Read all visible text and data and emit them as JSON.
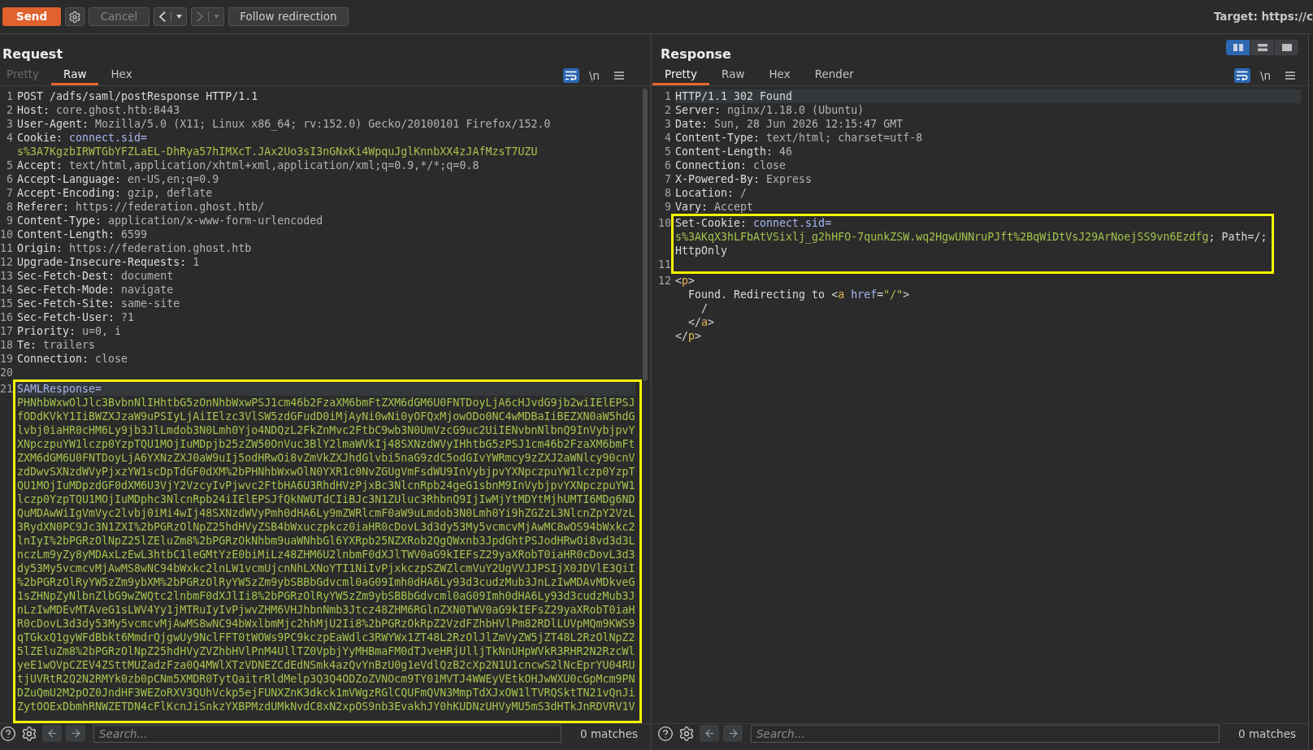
{
  "toolbar": {
    "send": {
      "label": "Send"
    },
    "cancel": {
      "label": "Cancel",
      "disabled": true
    },
    "back": {
      "disabled": false
    },
    "forward": {
      "disabled": true
    },
    "follow_redirection": {
      "label": "Follow redirection",
      "disabled": false
    },
    "target": "Target: https://c"
  },
  "request": {
    "title": "Request",
    "tabs": [
      {
        "label": "Pretty",
        "selected": false,
        "disabled": true
      },
      {
        "label": "Raw",
        "selected": true,
        "disabled": false
      },
      {
        "label": "Hex",
        "selected": false,
        "disabled": false
      }
    ],
    "wrap_lines": {
      "on": true
    },
    "show_newlines": {
      "label": "\\n",
      "on": false
    },
    "blocks": [
      {
        "kind": "plain",
        "lines": [
          {
            "number": "1",
            "current": false,
            "rows": [
              [
                {
                  "kind": "plain",
                  "text": "POST /adfs/saml/postResponse HTTP/1.1"
                }
              ]
            ]
          },
          {
            "number": "2",
            "current": false,
            "rows": [
              [
                {
                  "kind": "name",
                  "text": "Host:"
                },
                {
                  "kind": "value",
                  "text": " core.ghost.htb:8443"
                }
              ]
            ]
          },
          {
            "number": "3",
            "current": false,
            "rows": [
              [
                {
                  "kind": "name",
                  "text": "User-Agent:"
                },
                {
                  "kind": "value",
                  "text": " Mozilla/5.0 (X11; Linux x86_64; rv:152.0) Gecko/20100101 Firefox/152.0"
                }
              ]
            ]
          },
          {
            "number": "4",
            "current": false,
            "rows": [
              [
                {
                  "kind": "name",
                  "text": "Cookie:"
                },
                {
                  "kind": "param_name",
                  "text": " connect.sid="
                }
              ],
              [
                {
                  "kind": "param_value",
                  "text": "s%3A7KgzbIRWTGbYFZLaEL-DhRya57hIMXcT.JAx2Uo3sI3nGNxKi4WpquJglKnnbXX4zJAfMzsT7UZU"
                }
              ]
            ]
          },
          {
            "number": "5",
            "current": false,
            "rows": [
              [
                {
                  "kind": "name",
                  "text": "Accept:"
                },
                {
                  "kind": "value",
                  "text": " text/html,application/xhtml+xml,application/xml;q=0.9,*/*;q=0.8"
                }
              ]
            ]
          },
          {
            "number": "6",
            "current": false,
            "rows": [
              [
                {
                  "kind": "name",
                  "text": "Accept-Language:"
                },
                {
                  "kind": "value",
                  "text": " en-US,en;q=0.9"
                }
              ]
            ]
          },
          {
            "number": "7",
            "current": false,
            "rows": [
              [
                {
                  "kind": "name",
                  "text": "Accept-Encoding:"
                },
                {
                  "kind": "value",
                  "text": " gzip, deflate"
                }
              ]
            ]
          },
          {
            "number": "8",
            "current": false,
            "rows": [
              [
                {
                  "kind": "name",
                  "text": "Referer:"
                },
                {
                  "kind": "value",
                  "text": " https://federation.ghost.htb/"
                }
              ]
            ]
          },
          {
            "number": "9",
            "current": false,
            "rows": [
              [
                {
                  "kind": "name",
                  "text": "Content-Type:"
                },
                {
                  "kind": "value",
                  "text": " application/x-www-form-urlencoded"
                }
              ]
            ]
          },
          {
            "number": "10",
            "current": false,
            "rows": [
              [
                {
                  "kind": "name",
                  "text": "Content-Length:"
                },
                {
                  "kind": "value",
                  "text": " 6599"
                }
              ]
            ]
          },
          {
            "number": "11",
            "current": false,
            "rows": [
              [
                {
                  "kind": "name",
                  "text": "Origin:"
                },
                {
                  "kind": "value",
                  "text": " https://federation.ghost.htb"
                }
              ]
            ]
          },
          {
            "number": "12",
            "current": false,
            "rows": [
              [
                {
                  "kind": "name",
                  "text": "Upgrade-Insecure-Requests:"
                },
                {
                  "kind": "value",
                  "text": " 1"
                }
              ]
            ]
          },
          {
            "number": "13",
            "current": false,
            "rows": [
              [
                {
                  "kind": "name",
                  "text": "Sec-Fetch-Dest:"
                },
                {
                  "kind": "value",
                  "text": " document"
                }
              ]
            ]
          },
          {
            "number": "14",
            "current": false,
            "rows": [
              [
                {
                  "kind": "name",
                  "text": "Sec-Fetch-Mode:"
                },
                {
                  "kind": "value",
                  "text": " navigate"
                }
              ]
            ]
          },
          {
            "number": "15",
            "current": false,
            "rows": [
              [
                {
                  "kind": "name",
                  "text": "Sec-Fetch-Site:"
                },
                {
                  "kind": "value",
                  "text": " same-site"
                }
              ]
            ]
          },
          {
            "number": "16",
            "current": false,
            "rows": [
              [
                {
                  "kind": "name",
                  "text": "Sec-Fetch-User:"
                },
                {
                  "kind": "value",
                  "text": " ?1"
                }
              ]
            ]
          },
          {
            "number": "17",
            "current": false,
            "rows": [
              [
                {
                  "kind": "name",
                  "text": "Priority:"
                },
                {
                  "kind": "value",
                  "text": " u=0, i"
                }
              ]
            ]
          },
          {
            "number": "18",
            "current": false,
            "rows": [
              [
                {
                  "kind": "name",
                  "text": "Te:"
                },
                {
                  "kind": "value",
                  "text": " trailers"
                }
              ]
            ]
          },
          {
            "number": "19",
            "current": false,
            "rows": [
              [
                {
                  "kind": "name",
                  "text": "Connection:"
                },
                {
                  "kind": "value",
                  "text": " close"
                }
              ]
            ]
          },
          {
            "number": "20",
            "current": false
          }
        ]
      },
      {
        "kind": "framed",
        "lines": [
          {
            "number": "21",
            "current": true,
            "rows": [
              [
                {
                  "kind": "param_name",
                  "text": "SAMLResponse="
                }
              ],
              [
                {
                  "kind": "param_value",
                  "text": "PHNhbWxwOlJlc3BvbnNlIHhtbG5zOnNhbWxwPSJ1cm46b2FzaXM6bmFtZXM6dGM6U0FNTDoyLjA6cHJvdG9jb2wiIElEPSJ"
                }
              ],
              [
                {
                  "kind": "param_value",
                  "text": "fODdKVkY1IiBWZXJzaW9uPSIyLjAiIElzc3VlSW5zdGFudD0iMjAyNi0wNi0yOFQxMjowODo0NC4wMDBaIiBEZXN0aW5hdG"
                }
              ],
              [
                {
                  "kind": "param_value",
                  "text": "lvbj0iaHR0cHM6Ly9jb3JlLmdob3N0Lmh0Yjo4NDQzL2FkZnMvc2FtbC9wb3N0UmVzcG9uc2UiIENvbnNlbnQ9InVybjpvY"
                }
              ],
              [
                {
                  "kind": "param_value",
                  "text": "XNpczpuYW1lczp0YzpTQU1MOjIuMDpjb25zZW50OnVuc3BlY2lmaWVkIj48SXNzdWVyIHhtbG5zPSJ1cm46b2FzaXM6bmFt"
                }
              ],
              [
                {
                  "kind": "param_value",
                  "text": "ZXM6dGM6U0FNTDoyLjA6YXNzZXJ0aW9uIj5odHRwOi8vZmVkZXJhdGlvbi5naG9zdC5odGIvYWRmcy9zZXJ2aWNlcy90cnV"
                }
              ],
              [
                {
                  "kind": "param_value",
                  "text": "zdDwvSXNzdWVyPjxzYW1scDpTdGF0dXM%2bPHNhbWxwOlN0YXR1c0NvZGUgVmFsdWU9InVybjpvYXNpczpuYW1lczp0YzpT"
                }
              ],
              [
                {
                  "kind": "param_value",
                  "text": "QU1MOjIuMDpzdGF0dXM6U3VjY2VzcyIvPjwvc2FtbHA6U3RhdHVzPjxBc3NlcnRpb24geG1sbnM9InVybjpvYXNpczpuYW1"
                }
              ],
              [
                {
                  "kind": "param_value",
                  "text": "lczp0YzpTQU1MOjIuMDphc3NlcnRpb24iIElEPSJfQkNWUTdCIiBJc3N1ZUluc3RhbnQ9IjIwMjYtMDYtMjhUMTI6MDg6ND"
                }
              ],
              [
                {
                  "kind": "param_value",
                  "text": "QuMDAwWiIgVmVyc2lvbj0iMi4wIj48SXNzdWVyPmh0dHA6Ly9mZWRlcmF0aW9uLmdob3N0Lmh0Yi9hZGZzL3NlcnZpY2VzL"
                }
              ],
              [
                {
                  "kind": "param_value",
                  "text": "3RydXN0PC9Jc3N1ZXI%2bPGRzOlNpZ25hdHVyZSB4bWxuczpkcz0iaHR0cDovL3d3dy53My5vcmcvMjAwMC8wOS94bWxkc2"
                }
              ],
              [
                {
                  "kind": "param_value",
                  "text": "lnIyI%2bPGRzOlNpZ25lZEluZm8%2bPGRzOkNhbm9uaWNhbGl6YXRpb25NZXRob2QgQWxnb3JpdGhtPSJodHRwOi8vd3d3L"
                }
              ],
              [
                {
                  "kind": "param_value",
                  "text": "nczLm9yZy8yMDAxLzEwL3htbC1leGMtYzE0biMiLz48ZHM6U2lnbmF0dXJlTWV0aG9kIEFsZ29yaXRobT0iaHR0cDovL3d3"
                }
              ],
              [
                {
                  "kind": "param_value",
                  "text": "dy53My5vcmcvMjAwMS8wNC94bWxkc2lnLW1vcmUjcnNhLXNoYTI1NiIvPjxkczpSZWZlcmVuY2UgVVJJPSIjX0JDVlE3QiI"
                }
              ],
              [
                {
                  "kind": "param_value",
                  "text": "%2bPGRzOlRyYW5zZm9ybXM%2bPGRzOlRyYW5zZm9ybSBBbGdvcml0aG09Imh0dHA6Ly93d3cudzMub3JnLzIwMDAvMDkveG"
                }
              ],
              [
                {
                  "kind": "param_value",
                  "text": "1sZHNpZyNlbnZlbG9wZWQtc2lnbmF0dXJlIi8%2bPGRzOlRyYW5zZm9ybSBBbGdvcml0aG09Imh0dHA6Ly93d3cudzMub3J"
                }
              ],
              [
                {
                  "kind": "param_value",
                  "text": "nLzIwMDEvMTAveG1sLWV4Yy1jMTRuIyIvPjwvZHM6VHJhbnNmb3Jtcz48ZHM6RGlnZXN0TWV0aG9kIEFsZ29yaXRobT0iaH"
                }
              ],
              [
                {
                  "kind": "param_value",
                  "text": "R0cDovL3d3dy53My5vcmcvMjAwMS8wNC94bWxlbmMjc2hhMjU2Ii8%2bPGRzOkRpZ2VzdFZhbHVlPm82RDlLUVpMQm9KWS9"
                }
              ],
              [
                {
                  "kind": "param_value",
                  "text": "qTGkxQ1gyWFdBbkt6MmdrQjgwUy9NclFFT0tWOWs9PC9kczpEaWdlc3RWYWx1ZT48L2RzOlJlZmVyZW5jZT48L2RzOlNpZ2"
                }
              ],
              [
                {
                  "kind": "param_value",
                  "text": "5lZEluZm8%2bPGRzOlNpZ25hdHVyZVZhbHVlPnM4UllTZ0VpbjYyMHBmaFM0dTJveHRjUlljTkNnUHpWVkR3RHR2N2RzcWl"
                }
              ],
              [
                {
                  "kind": "param_value",
                  "text": "yeE1wOVpCZEV4ZSttMUZadzFza0Q4MWlXTzVDNEZCdEdNSmk4azQvYnBzU0g1eVdlQzB2cXp2N1U1cncwS2lNcEprYU04RU"
                }
              ],
              [
                {
                  "kind": "param_value",
                  "text": "tjUVRtR2Q2N2RMYk0zb0pCNm5XMDR0TytQaitrRldMelp3Q3Q4ODZoZVNOcm9TY01MVTJ4WWEyVEtkOHJwWXU0cGpMcm9PN"
                }
              ],
              [
                {
                  "kind": "param_value",
                  "text": "DZuQmU2M2pOZ0JndHF3WEZoRXV3QUhVckp5ejFUNXZnK3dkck1mVWgzRGlCQUFmQVN3MmpTdXJxOW1lTVRQSktTN21vQnJi"
                }
              ],
              [
                {
                  "kind": "param_value",
                  "text": "ZytOOExDbmhRNWZETDN4cFlKcnJiSnkzYXBPMzdUMkNvdC8xN2xpOS9nb3EvakhJY0hKUDNzUHVyMU5mS3dHTkJnRDVRV1V"
                }
              ]
            ]
          }
        ]
      }
    ],
    "search": {
      "placeholder": "Search..."
    },
    "match_count": "0 matches"
  },
  "response": {
    "title": "Response",
    "layout_buttons": [
      {
        "kind": "columns",
        "selected": true
      },
      {
        "kind": "rows",
        "selected": false
      },
      {
        "kind": "single",
        "selected": false
      }
    ],
    "tabs": [
      {
        "label": "Pretty",
        "selected": true,
        "disabled": false
      },
      {
        "label": "Raw",
        "selected": false,
        "disabled": false
      },
      {
        "label": "Hex",
        "selected": false,
        "disabled": false
      },
      {
        "label": "Render",
        "selected": false,
        "disabled": false
      }
    ],
    "wrap_lines": {
      "on": true
    },
    "show_newlines": {
      "label": "\\n",
      "on": false
    },
    "blocks": [
      {
        "kind": "plain",
        "lines": [
          {
            "number": "1",
            "current": true,
            "rows": [
              [
                {
                  "kind": "plain",
                  "text": "HTTP/1.1 302 Found"
                }
              ]
            ]
          },
          {
            "number": "2",
            "current": false,
            "rows": [
              [
                {
                  "kind": "name",
                  "text": "Server:"
                },
                {
                  "kind": "value",
                  "text": " nginx/1.18.0 (Ubuntu)"
                }
              ]
            ]
          },
          {
            "number": "3",
            "current": false,
            "rows": [
              [
                {
                  "kind": "name",
                  "text": "Date:"
                },
                {
                  "kind": "value",
                  "text": " Sun, 28 Jun 2026 12:15:47 GMT"
                }
              ]
            ]
          },
          {
            "number": "4",
            "current": false,
            "rows": [
              [
                {
                  "kind": "name",
                  "text": "Content-Type:"
                },
                {
                  "kind": "value",
                  "text": " text/html; charset=utf-8"
                }
              ]
            ]
          },
          {
            "number": "5",
            "current": false,
            "rows": [
              [
                {
                  "kind": "name",
                  "text": "Content-Length:"
                },
                {
                  "kind": "value",
                  "text": " 46"
                }
              ]
            ]
          },
          {
            "number": "6",
            "current": false,
            "rows": [
              [
                {
                  "kind": "name",
                  "text": "Connection:"
                },
                {
                  "kind": "value",
                  "text": " close"
                }
              ]
            ]
          },
          {
            "number": "7",
            "current": false,
            "rows": [
              [
                {
                  "kind": "name",
                  "text": "X-Powered-By:"
                },
                {
                  "kind": "value",
                  "text": " Express"
                }
              ]
            ]
          },
          {
            "number": "8",
            "current": false,
            "rows": [
              [
                {
                  "kind": "name",
                  "text": "Location:"
                },
                {
                  "kind": "value",
                  "text": " /"
                }
              ]
            ]
          },
          {
            "number": "9",
            "current": false,
            "rows": [
              [
                {
                  "kind": "name",
                  "text": "Vary:"
                },
                {
                  "kind": "value",
                  "text": " Accept"
                }
              ]
            ]
          }
        ]
      },
      {
        "kind": "framed",
        "lines": [
          {
            "number": "10",
            "current": false,
            "rows": [
              [
                {
                  "kind": "name",
                  "text": "Set-Cookie:"
                },
                {
                  "kind": "param_name",
                  "text": " connect.sid="
                }
              ],
              [
                {
                  "kind": "param_value",
                  "text": "s%3AKqX3hLFbAtVSixlj_g2hHFO-7qunkZSW.wq2HgwUNNruPJft%2BqWiDtVsJ29ArNoejSS9vn6Ezdfg"
                },
                {
                  "kind": "plain",
                  "text": "; Path=/;"
                }
              ],
              [
                {
                  "kind": "plain",
                  "text": "HttpOnly"
                }
              ]
            ]
          },
          {
            "number": "11",
            "current": false
          }
        ]
      },
      {
        "kind": "plain",
        "lines": [
          {
            "number": "12",
            "current": false,
            "rows": [
              [
                {
                  "kind": "punct",
                  "text": "<"
                },
                {
                  "kind": "tag",
                  "text": "p"
                },
                {
                  "kind": "punct",
                  "text": ">"
                }
              ],
              [
                {
                  "kind": "plain",
                  "text": "  Found. Redirecting to "
                },
                {
                  "kind": "punct",
                  "text": "<"
                },
                {
                  "kind": "tag",
                  "text": "a"
                },
                {
                  "kind": "plain",
                  "text": " "
                },
                {
                  "kind": "attribute",
                  "text": "href"
                },
                {
                  "kind": "punct",
                  "text": "="
                },
                {
                  "kind": "string",
                  "text": "\"/\""
                },
                {
                  "kind": "punct",
                  "text": ">"
                }
              ],
              [
                {
                  "kind": "plain",
                  "text": "    /"
                }
              ],
              [
                {
                  "kind": "punct",
                  "text": "  </"
                },
                {
                  "kind": "tag",
                  "text": "a"
                },
                {
                  "kind": "punct",
                  "text": ">"
                }
              ],
              [
                {
                  "kind": "punct",
                  "text": "</"
                },
                {
                  "kind": "tag",
                  "text": "p"
                },
                {
                  "kind": "punct",
                  "text": ">"
                }
              ]
            ]
          }
        ]
      }
    ],
    "search": {
      "placeholder": "Search..."
    },
    "match_count": "0 matches"
  }
}
